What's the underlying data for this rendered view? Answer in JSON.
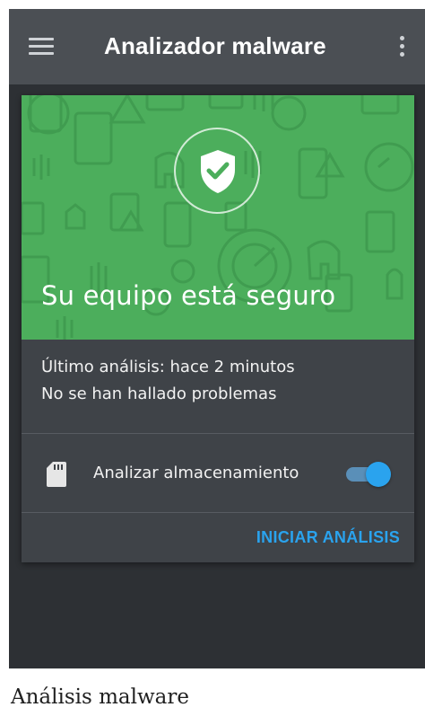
{
  "appbar": {
    "title": "Analizador malware",
    "menu_icon": "hamburger-menu-icon",
    "more_icon": "more-vert-icon"
  },
  "hero": {
    "message": "Su equipo está seguro",
    "icon": "shield-check-icon",
    "background_color": "#4cae5c"
  },
  "status": {
    "last_scan": "Último análisis: hace 2 minutos",
    "result": "No se han hallado problemas"
  },
  "storage": {
    "icon": "sd-card-icon",
    "label": "Analizar almacenamiento",
    "toggle_on": true
  },
  "actions": {
    "start_scan": "INICIAR ANÁLISIS"
  },
  "caption": "Análisis malware",
  "colors": {
    "accent": "#2aa3ee",
    "appbar": "#4b4f54",
    "card": "#3f4348",
    "background": "#2d3034"
  }
}
